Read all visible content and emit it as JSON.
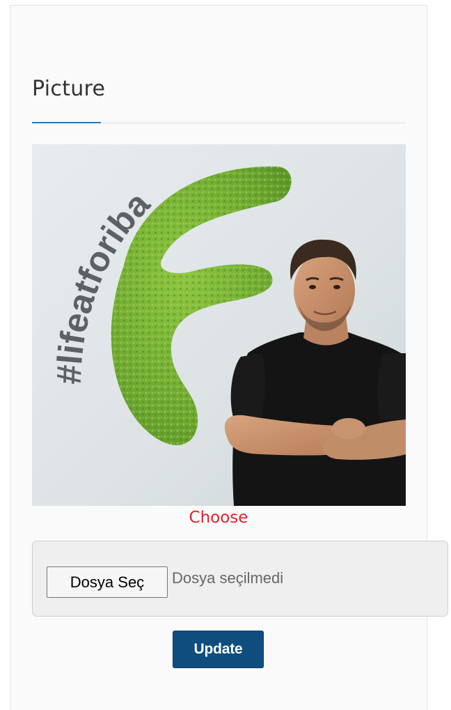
{
  "section": {
    "title": "Picture"
  },
  "photo": {
    "wall_text": "#lifeatforiba",
    "brand_color": "#5f9e2c"
  },
  "choose": {
    "label": "Choose",
    "color": "#e8212b"
  },
  "file_input": {
    "button_label": "Dosya Seç",
    "status_text": "Dosya seçilmedi"
  },
  "update": {
    "label": "Update",
    "color": "#0e4d7e"
  },
  "accent_color": "#2a77b4"
}
